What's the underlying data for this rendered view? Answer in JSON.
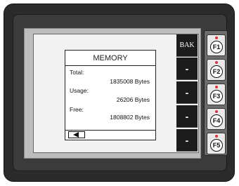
{
  "dialog": {
    "title": "MEMORY",
    "rows": [
      {
        "label": "Total:",
        "value": "1835008 Bytes"
      },
      {
        "label": "Usage:",
        "value": "26206 Bytes"
      },
      {
        "label": "Free:",
        "value": "1808802 Bytes"
      }
    ],
    "back_icon": "left-arrow-icon"
  },
  "softkeys": [
    {
      "label": "BAK"
    },
    {
      "label": "-"
    },
    {
      "label": "-"
    },
    {
      "label": "-"
    },
    {
      "label": "-"
    }
  ],
  "function_keys": [
    {
      "label": "F1"
    },
    {
      "label": "F2"
    },
    {
      "label": "F3"
    },
    {
      "label": "F4"
    },
    {
      "label": "F5"
    }
  ],
  "colors": {
    "bezel": "#2b2b2b",
    "screen": "#f2f2f2",
    "softkey": "#1c1c1c",
    "led": "#dd3333"
  }
}
